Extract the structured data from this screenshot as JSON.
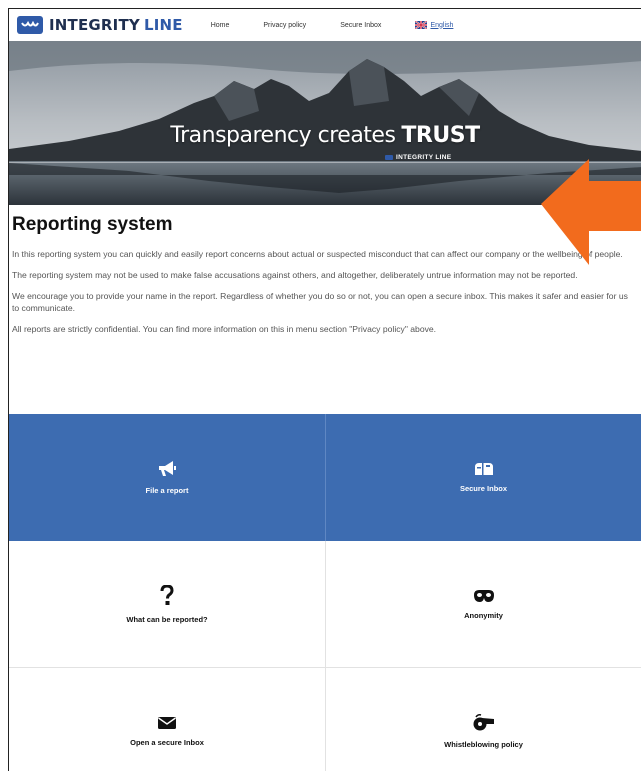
{
  "brand": {
    "name_part1": "INTEGRITY",
    "name_part2": "LINE"
  },
  "nav": {
    "items": [
      {
        "label": "Home"
      },
      {
        "label": "Privacy policy"
      },
      {
        "label": "Secure Inbox"
      }
    ],
    "language": "English"
  },
  "hero": {
    "title_thin": "Transparency creates",
    "title_bold": "TRUST",
    "brand": "INTEGRITY LINE"
  },
  "content": {
    "title": "Reporting system",
    "paragraphs": [
      "In this reporting system you can quickly and easily report concerns about actual or suspected misconduct that can affect our company or the wellbeing of people.",
      "The reporting system may not be used to make false accusations against others, and altogether, deliberately untrue information may not be reported.",
      "We encourage you to provide your name in the report. Regardless of whether you do so or not, you can open a secure inbox. This makes it safer and easier for us to communicate.",
      "All reports are strictly confidential. You can find more information on this in menu section \"Privacy policy\" above."
    ]
  },
  "tiles": {
    "file_report": "File a report",
    "secure_inbox": "Secure Inbox",
    "what_reported": "What can be reported?",
    "anonymity": "Anonymity",
    "open_inbox": "Open a secure Inbox",
    "whistleblowing": "Whistleblowing policy"
  },
  "colors": {
    "brand_blue": "#3d6cb1",
    "dark_navy": "#1f2f4f",
    "arrow": "#f26b1d"
  }
}
